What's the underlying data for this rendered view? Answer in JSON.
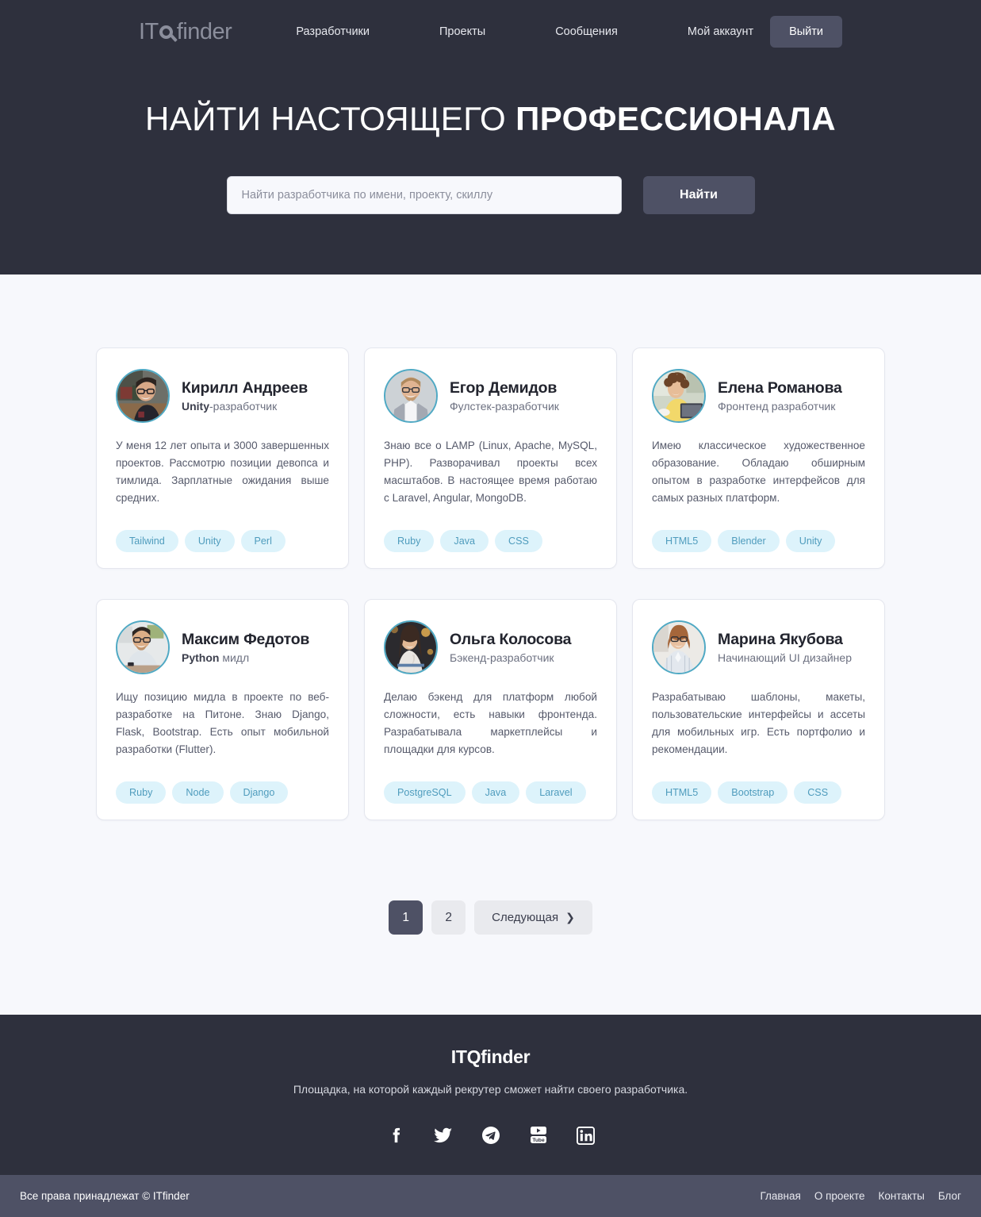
{
  "header": {
    "logo": {
      "prefix": "IT",
      "glass": "Q",
      "suffix": "finder"
    },
    "nav": [
      {
        "label": "Разработчики",
        "name": "nav-developers"
      },
      {
        "label": "Проекты",
        "name": "nav-projects"
      },
      {
        "label": "Сообщения",
        "name": "nav-messages"
      },
      {
        "label": "Мой аккаунт",
        "name": "nav-account"
      }
    ],
    "logout_label": "Выйти"
  },
  "hero": {
    "title_light": "НАЙТИ НАСТОЯЩЕГО ",
    "title_bold": "ПРОФЕССИОНАЛА",
    "search_placeholder": "Найти разработчика по имени, проекту, скиллу",
    "search_value": "",
    "search_button": "Найти"
  },
  "colors": {
    "dark": "#2e303d",
    "slate": "#4e5165",
    "page_bg": "#f7f8fc",
    "card_bg": "#ffffff",
    "card_border": "#e4e6ee",
    "tag_bg": "#ddf3fb",
    "tag_text": "#4f9cbd",
    "avatar_ring": "#4fa9c4"
  },
  "cards": [
    {
      "name": "Кирилл Андреев",
      "role_highlight": "Unity",
      "role_rest": "-разработчик",
      "bio": "У меня 12 лет опыта и 3000 завершенных проектов. Рассмотрю позиции девопса и тимлида. Зарплатные ожидания выше средних.",
      "tags": [
        "Tailwind",
        "Unity",
        "Perl"
      ],
      "avatar": "photo-man-glasses-dark"
    },
    {
      "name": "Егор Демидов",
      "role_highlight": "",
      "role_rest": "Фулстек-разработчик",
      "bio": "Знаю все о LAMP (Linux, Apache, MySQL, PHP). Разворачивал проекты всех масштабов. В настоящее время работаю с Laravel, Angular, MongoDB.",
      "tags": [
        "Ruby",
        "Java",
        "CSS"
      ],
      "avatar": "photo-man-grey-jacket"
    },
    {
      "name": "Елена Романова",
      "role_highlight": "",
      "role_rest": "Фронтенд разработчик",
      "bio": "Имею классическое художественное образование. Обладаю обширным опытом в разработке интерфейсов для самых разных платформ.",
      "tags": [
        "HTML5",
        "Blender",
        "Unity"
      ],
      "avatar": "photo-woman-curly-laptop"
    },
    {
      "name": "Максим Федотов",
      "role_highlight": "Python",
      "role_rest": " мидл",
      "bio": "Ищу позицию мидла в проекте по веб-разработке на Питоне. Знаю Django, Flask, Bootstrap. Есть опыт мобильной разработки (Flutter).",
      "tags": [
        "Ruby",
        "Node",
        "Django"
      ],
      "avatar": "photo-man-white-shirt"
    },
    {
      "name": "Ольга Колосова",
      "role_highlight": "",
      "role_rest": "Бэкенд-разработчик",
      "bio": "Делаю бэкенд для платформ любой сложности, есть навыки фронтенда. Разрабатывала маркетплейсы и площадки для курсов.",
      "tags": [
        "PostgreSQL",
        "Java",
        "Laravel"
      ],
      "avatar": "photo-woman-dark-hair"
    },
    {
      "name": "Марина Якубова",
      "role_highlight": "",
      "role_rest": "Начинающий UI дизайнер",
      "bio": "Разрабатываю шаблоны, макеты, пользовательские интерфейсы и ассеты для мобильных игр. Есть портфолио и рекомендации.",
      "tags": [
        "HTML5",
        "Bootstrap",
        "CSS"
      ],
      "avatar": "photo-woman-striped-shirt"
    }
  ],
  "pagination": {
    "pages": [
      {
        "label": "1",
        "active": true
      },
      {
        "label": "2",
        "active": false
      }
    ],
    "next_label": "Следующая",
    "next_chevron": "❯"
  },
  "footer": {
    "logo": "ITQfinder",
    "tagline": "Площадка, на которой каждый рекрутер сможет найти своего разработчика.",
    "socials": [
      {
        "name": "facebook-icon"
      },
      {
        "name": "twitter-icon"
      },
      {
        "name": "telegram-icon"
      },
      {
        "name": "youtube-icon"
      },
      {
        "name": "linkedin-icon"
      }
    ],
    "copyright": "Все права принадлежат © ITfinder",
    "links": [
      {
        "label": "Главная",
        "name": "footer-link-home"
      },
      {
        "label": "О проекте",
        "name": "footer-link-about"
      },
      {
        "label": "Контакты",
        "name": "footer-link-contacts"
      },
      {
        "label": "Блог",
        "name": "footer-link-blog"
      }
    ]
  }
}
